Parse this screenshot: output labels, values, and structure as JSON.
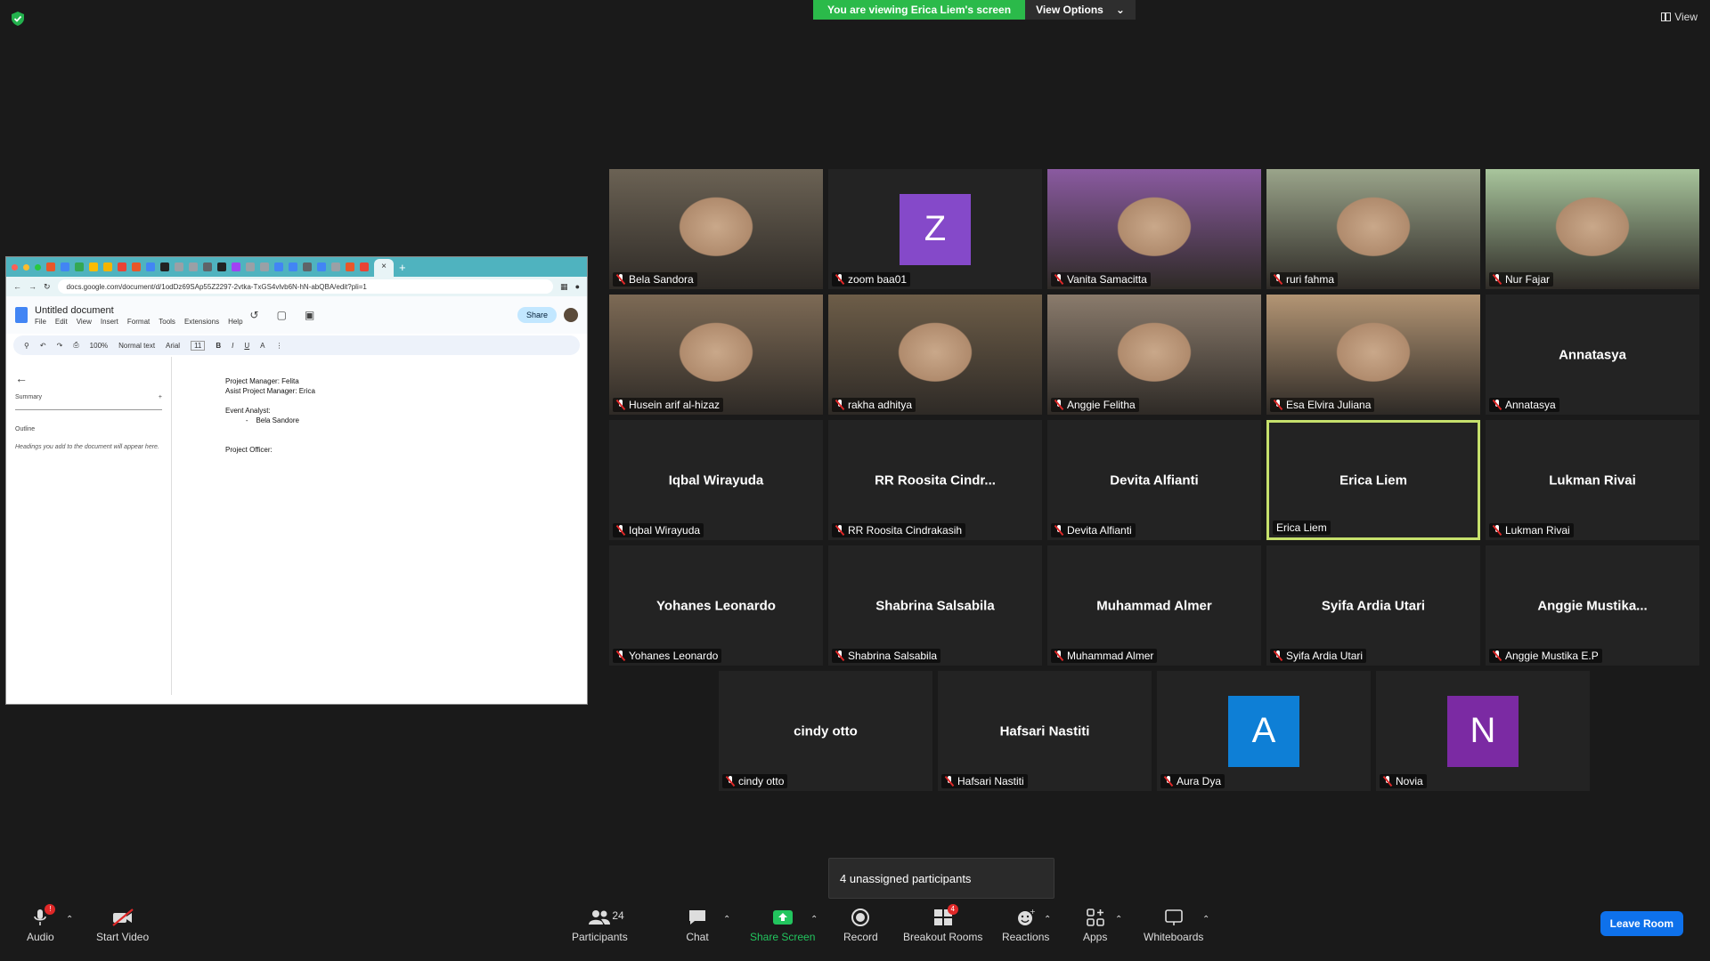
{
  "top": {
    "viewing_banner": "You are viewing Erica Liem's screen",
    "view_options": "View Options",
    "view": "View"
  },
  "shared_screen": {
    "url": "docs.google.com/document/d/1odDz69SAp55Z2297-2vtka-TxGS4vlvb6N-hN-abQBA/edit?pli=1",
    "doc_title": "Untitled document",
    "menu": [
      "File",
      "Edit",
      "View",
      "Insert",
      "Format",
      "Tools",
      "Extensions",
      "Help"
    ],
    "share": "Share",
    "zoom": "100%",
    "style": "Normal text",
    "font": "Arial",
    "font_size": "11",
    "summary": "Summary",
    "outline": "Outline",
    "outline_hint": "Headings you add to the document will appear here.",
    "lines": [
      "Project Manager: Felita",
      "Asist Project Manager: Erica",
      "",
      "Event Analyst:",
      "    -    Bela Sandore",
      "",
      "",
      "Project Officer:"
    ]
  },
  "participants": [
    {
      "name": "Bela Sandora",
      "type": "video",
      "tone": "#6b6254"
    },
    {
      "name": "zoom baa01",
      "type": "avatar",
      "initial": "Z",
      "color": "#8549c9"
    },
    {
      "name": "Vanita Samacitta",
      "type": "video",
      "tone": "#8a5aa0"
    },
    {
      "name": "ruri fahma",
      "type": "video",
      "tone": "#9aa48a"
    },
    {
      "name": "Nur Fajar",
      "type": "video",
      "tone": "#a8c59c"
    },
    {
      "name": "Husein arif al-hizaz",
      "type": "video",
      "tone": "#7d6a55"
    },
    {
      "name": "rakha adhitya",
      "type": "video",
      "tone": "#6d5d48"
    },
    {
      "name": "Anggie Felitha",
      "type": "video",
      "tone": "#8a7b6c"
    },
    {
      "name": "Esa Elvira Juliana",
      "type": "video",
      "tone": "#b39574"
    },
    {
      "name": "Annatasya",
      "type": "name",
      "big": "Annatasya"
    },
    {
      "name": "Iqbal Wirayuda",
      "type": "name",
      "big": "Iqbal Wirayuda"
    },
    {
      "name": "RR Roosita Cindrakasih",
      "type": "name",
      "big": "RR Roosita Cindr..."
    },
    {
      "name": "Devita Alfianti",
      "type": "name",
      "big": "Devita Alfianti"
    },
    {
      "name": "Erica Liem",
      "type": "name",
      "big": "Erica Liem",
      "active": true
    },
    {
      "name": "Lukman Rivai",
      "type": "name",
      "big": "Lukman Rivai"
    },
    {
      "name": "Yohanes Leonardo",
      "type": "name",
      "big": "Yohanes Leonardo"
    },
    {
      "name": "Shabrina Salsabila",
      "type": "name",
      "big": "Shabrina Salsabila"
    },
    {
      "name": "Muhammad Almer",
      "type": "name",
      "big": "Muhammad Almer"
    },
    {
      "name": "Syifa Ardia Utari",
      "type": "name",
      "big": "Syifa Ardia Utari"
    },
    {
      "name": "Anggie Mustika E.P",
      "type": "name",
      "big": "Anggie  Mustika..."
    },
    {
      "name": "cindy otto",
      "type": "name",
      "big": "cindy otto"
    },
    {
      "name": "Hafsari Nastiti",
      "type": "name",
      "big": "Hafsari Nastiti"
    },
    {
      "name": "Aura Dya",
      "type": "avatar",
      "initial": "A",
      "color": "#0e7fd6"
    },
    {
      "name": "Novia",
      "type": "avatar",
      "initial": "N",
      "color": "#7b2aa3"
    }
  ],
  "unassigned": "4 unassigned participants",
  "toolbar": {
    "audio": "Audio",
    "audio_badge": "!",
    "start_video": "Start Video",
    "participants": "Participants",
    "participants_count": "24",
    "chat": "Chat",
    "share_screen": "Share Screen",
    "record": "Record",
    "breakout_rooms": "Breakout Rooms",
    "breakout_badge": "4",
    "reactions": "Reactions",
    "apps": "Apps",
    "whiteboards": "Whiteboards",
    "leave": "Leave Room"
  },
  "colors": {
    "banner": "#2bba4a",
    "share_screen": "#22c55e",
    "leave": "#0e71eb",
    "active_speaker": "#c6e06c"
  }
}
